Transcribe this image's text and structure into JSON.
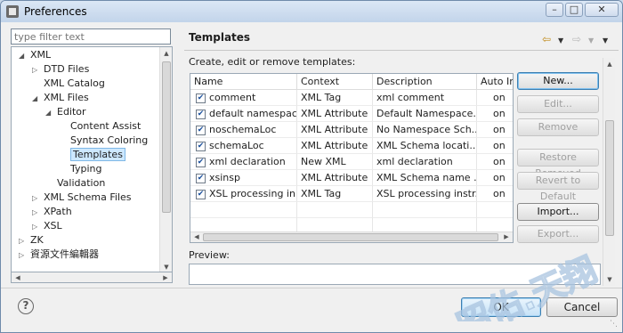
{
  "window": {
    "title": "Preferences"
  },
  "sidebar": {
    "filter_placeholder": "type filter text",
    "tree": [
      {
        "label": "XML",
        "indent": 0,
        "twisty": "open"
      },
      {
        "label": "DTD Files",
        "indent": 1,
        "twisty": "closed"
      },
      {
        "label": "XML Catalog",
        "indent": 1,
        "twisty": "none"
      },
      {
        "label": "XML Files",
        "indent": 1,
        "twisty": "open"
      },
      {
        "label": "Editor",
        "indent": 2,
        "twisty": "open"
      },
      {
        "label": "Content Assist",
        "indent": 3,
        "twisty": "none"
      },
      {
        "label": "Syntax Coloring",
        "indent": 3,
        "twisty": "none"
      },
      {
        "label": "Templates",
        "indent": 3,
        "twisty": "none",
        "selected": true
      },
      {
        "label": "Typing",
        "indent": 3,
        "twisty": "none"
      },
      {
        "label": "Validation",
        "indent": 2,
        "twisty": "none"
      },
      {
        "label": "XML Schema Files",
        "indent": 1,
        "twisty": "closed"
      },
      {
        "label": "XPath",
        "indent": 1,
        "twisty": "closed"
      },
      {
        "label": "XSL",
        "indent": 1,
        "twisty": "closed"
      },
      {
        "label": "ZK",
        "indent": 0,
        "twisty": "closed"
      },
      {
        "label": "資源文件編輯器",
        "indent": 0,
        "twisty": "closed"
      }
    ]
  },
  "main": {
    "title": "Templates",
    "description": "Create, edit or remove templates:",
    "columns": [
      "Name",
      "Context",
      "Description",
      "Auto In"
    ],
    "rows": [
      {
        "checked": true,
        "name": "comment",
        "context": "XML Tag",
        "description": "xml comment",
        "auto": "on"
      },
      {
        "checked": true,
        "name": "default namespace",
        "context": "XML Attribute",
        "description": "Default Namespace...",
        "auto": "on"
      },
      {
        "checked": true,
        "name": "noschemaLoc",
        "context": "XML Attribute",
        "description": "No Namespace Sch...",
        "auto": "on"
      },
      {
        "checked": true,
        "name": "schemaLoc",
        "context": "XML Attribute",
        "description": "XML Schema locati...",
        "auto": "on"
      },
      {
        "checked": true,
        "name": "xml declaration",
        "context": "New XML",
        "description": "xml declaration",
        "auto": "on"
      },
      {
        "checked": true,
        "name": "xsinsp",
        "context": "XML Attribute",
        "description": "XML Schema name ...",
        "auto": "on"
      },
      {
        "checked": true,
        "name": "XSL processing in...",
        "context": "XML Tag",
        "description": "XSL processing instr...",
        "auto": "on"
      }
    ],
    "buttons": {
      "new": "New...",
      "edit": "Edit...",
      "remove": "Remove",
      "restore_removed": "Restore Removed",
      "revert_to_default": "Revert to Default",
      "import": "Import...",
      "export": "Export..."
    },
    "preview_label": "Preview:"
  },
  "footer": {
    "ok": "OK",
    "cancel": "Cancel",
    "help_glyph": "?"
  },
  "watermark_text": "昭佑.天翔",
  "colors": {
    "selection": "#cde8ff",
    "accent": "#3c7fb1"
  }
}
